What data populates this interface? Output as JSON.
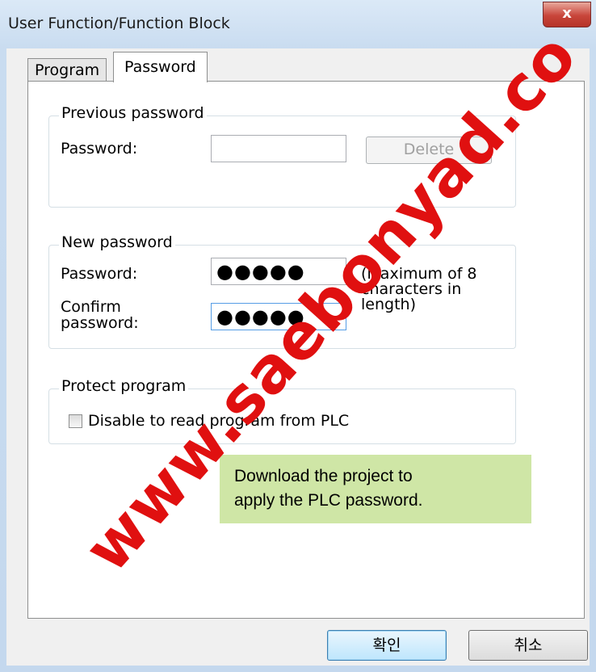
{
  "window": {
    "title": "User Function/Function Block",
    "close_glyph": "x"
  },
  "tabs": [
    {
      "label": "Program"
    },
    {
      "label": "Password"
    }
  ],
  "previous_password": {
    "group_title": "Previous password",
    "password_label": "Password:",
    "password_value": "",
    "delete_label": "Delete"
  },
  "new_password": {
    "group_title": "New password",
    "password_label": "Password:",
    "password_value": "●●●●●",
    "confirm_label_line1": "Confirm",
    "confirm_label_line2": "password:",
    "confirm_value": "●●●●●",
    "hint_line1": "(Maximum of 8",
    "hint_line2": "characters in",
    "hint_line3": "length)"
  },
  "protect": {
    "group_title": "Protect program",
    "checkbox_label": "Disable to read program from PLC",
    "checked": false
  },
  "note": {
    "line1": "Download the project to",
    "line2": "apply the PLC password."
  },
  "footer": {
    "ok_label": "확인",
    "cancel_label": "취소"
  },
  "watermark": "www.saebonyad.co",
  "colors": {
    "accent": "#569de5",
    "note_bg": "#cfe6a6",
    "watermark": "#e01010",
    "close_button": "#c8453a"
  }
}
